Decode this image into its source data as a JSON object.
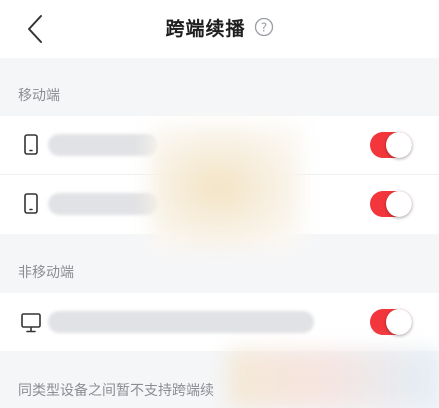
{
  "header": {
    "title": "跨端续播",
    "back_icon": "chevron-left-icon",
    "help_icon": "question-circle-icon"
  },
  "sections": [
    {
      "label": "移动端",
      "devices": [
        {
          "icon": "phone-icon",
          "enabled": true
        },
        {
          "icon": "phone-icon",
          "enabled": true
        }
      ]
    },
    {
      "label": "非移动端",
      "devices": [
        {
          "icon": "monitor-icon",
          "enabled": true
        }
      ]
    }
  ],
  "footer": {
    "note": "同类型设备之间暂不支持跨端续"
  },
  "colors": {
    "toggle_on": "#f2363c",
    "page_bg": "#f5f6f8",
    "card_bg": "#ffffff",
    "label_gray": "#8a8d93"
  }
}
